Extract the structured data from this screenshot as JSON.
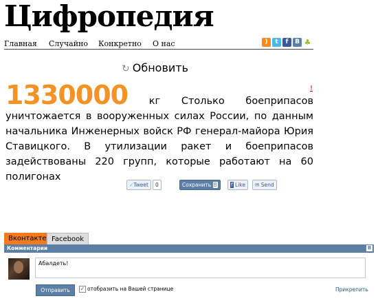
{
  "site": {
    "title": "Цифропедия"
  },
  "nav": {
    "items": [
      "Главная",
      "Случайно",
      "Конкретно",
      "О нас"
    ]
  },
  "social_icons": [
    "rss-icon",
    "twitter-icon",
    "facebook-icon",
    "vkontakte-icon",
    "android-icon"
  ],
  "refresh": {
    "label": "Обновить"
  },
  "fact": {
    "number": "1330000",
    "unit": "кг",
    "text": "Столько боеприпасов уничтожается в вооруженных силах России, по данным начальника Инженерных войск РФ генерал-майора Юрия Ставицкого. В утилизации ракет и боеприпасов задействованы 220 групп, которые работают на 60 полигонах",
    "flag": "!"
  },
  "share": {
    "tweet": "Tweet",
    "tweet_count": "0",
    "save": "Сохранить",
    "vk_letter": "B",
    "like": "Like",
    "send": "Send"
  },
  "comments": {
    "tabs": [
      "Вконтакте",
      "Facebook"
    ],
    "header": "Комментарии",
    "text": "Абалдеть!",
    "submit": "Отправить",
    "checkbox_label": "отобразить на Вашей странице",
    "attach": "Прикрепить"
  },
  "colors": {
    "accent": "#f39326",
    "vk_blue": "#5b7fa6",
    "active_tab": "#f47a20"
  }
}
